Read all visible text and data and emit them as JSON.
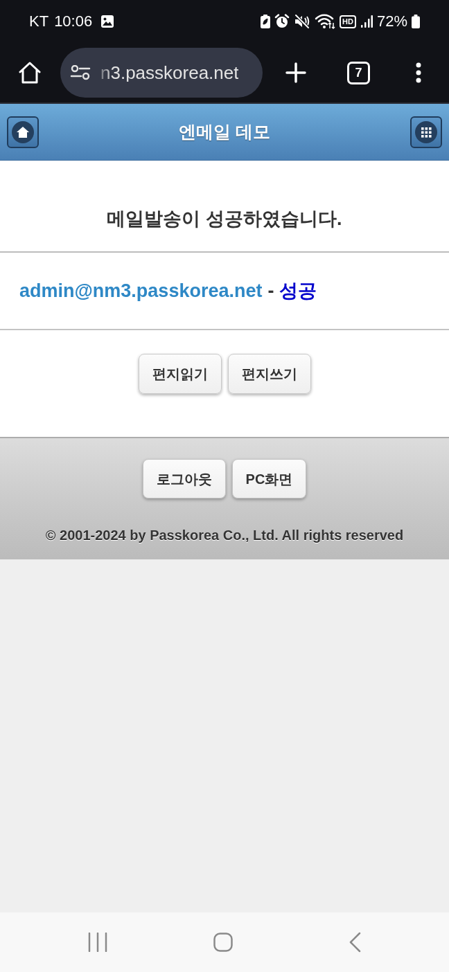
{
  "status_bar": {
    "carrier": "KT",
    "time": "10:06",
    "network_badge": "HD",
    "battery": "72%"
  },
  "browser_toolbar": {
    "url": "n3.passkorea.net",
    "tab_count": "7"
  },
  "header": {
    "title": "엔메일 데모"
  },
  "result": {
    "heading": "메일발송이 성공하였습니다.",
    "recipients": [
      {
        "address": "admin@nm3.passkorea.net",
        "separator": "-",
        "status": "성공"
      }
    ]
  },
  "actions": [
    {
      "label": "편지읽기"
    },
    {
      "label": "편지쓰기"
    }
  ],
  "footer": {
    "buttons": [
      {
        "label": "로그아웃"
      },
      {
        "label": "PC화면"
      }
    ],
    "copyright": "© 2001-2024 by Passkorea Co., Ltd. All rights reserved"
  }
}
